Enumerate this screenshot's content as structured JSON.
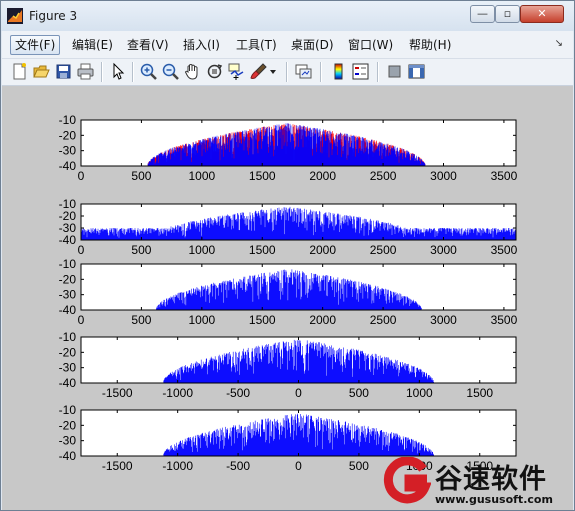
{
  "window": {
    "title": "Figure 3",
    "controls": {
      "minimize": "—",
      "maximize": "▫",
      "close": "✕"
    }
  },
  "menu": {
    "items": [
      {
        "label": "文件(F)",
        "active": true
      },
      {
        "label": "编辑(E)"
      },
      {
        "label": "查看(V)"
      },
      {
        "label": "插入(I)"
      },
      {
        "label": "工具(T)"
      },
      {
        "label": "桌面(D)"
      },
      {
        "label": "窗口(W)"
      },
      {
        "label": "帮助(H)"
      }
    ],
    "corner_glyph": "↘"
  },
  "toolbar": {
    "icons": [
      "new-figure-icon",
      "open-file-icon",
      "save-icon",
      "print-icon",
      "edit-plot-arrow-icon",
      "zoom-in-icon",
      "zoom-out-icon",
      "pan-hand-icon",
      "rotate-3d-icon",
      "data-cursor-icon",
      "brush-icon",
      "brush-dropdown-icon",
      "link-plot-icon",
      "insert-colorbar-icon",
      "insert-legend-icon",
      "hide-plot-tools-icon",
      "show-plot-tools-icon"
    ]
  },
  "colors": {
    "series_red": "#ff0000",
    "series_blue": "#0000ff",
    "figure_bg": "#c8c8c8"
  },
  "chart_data": [
    {
      "type": "line",
      "xlim": [
        0,
        3600
      ],
      "ylim": [
        -40,
        -10
      ],
      "xticks": [
        0,
        500,
        1000,
        1500,
        2000,
        2500,
        3000,
        3500
      ],
      "yticks": [
        -10,
        -20,
        -30,
        -40
      ],
      "envelope": {
        "center": 1700,
        "half_width": 1150,
        "peak": -12,
        "periodic": 3600
      },
      "series": [
        {
          "color": "red",
          "x_range": [
            0,
            2950
          ]
        },
        {
          "color": "blue",
          "x_range": [
            0,
            3600
          ]
        }
      ]
    },
    {
      "type": "line",
      "xlim": [
        0,
        3600
      ],
      "ylim": [
        -40,
        -10
      ],
      "xticks": [
        0,
        500,
        1000,
        1500,
        2000,
        2500,
        3000,
        3500
      ],
      "yticks": [
        -10,
        -20,
        -30,
        -40
      ],
      "envelope": {
        "center": 1700,
        "half_width": 1150,
        "peak": -12,
        "periodic": 3600,
        "floor": -30
      },
      "series": [
        {
          "color": "blue",
          "x_range": [
            0,
            3600
          ]
        }
      ]
    },
    {
      "type": "line",
      "xlim": [
        0,
        3600
      ],
      "ylim": [
        -40,
        -10
      ],
      "xticks": [
        0,
        500,
        1000,
        1500,
        2000,
        2500,
        3000,
        3500
      ],
      "yticks": [
        -10,
        -20,
        -30,
        -40
      ],
      "envelope": {
        "center": 1720,
        "half_width": 1100,
        "peak": -13
      },
      "series": [
        {
          "color": "blue",
          "x_range": [
            620,
            2830
          ]
        }
      ]
    },
    {
      "type": "line",
      "xlim": [
        -1800,
        1800
      ],
      "ylim": [
        -40,
        -10
      ],
      "xticks": [
        -1500,
        -1000,
        -500,
        0,
        500,
        1000,
        1500
      ],
      "yticks": [
        -10,
        -20,
        -30,
        -40
      ],
      "envelope": {
        "center": 0,
        "half_width": 1120,
        "peak": -11
      },
      "series": [
        {
          "color": "blue",
          "x_range": [
            -1120,
            1120
          ]
        }
      ]
    },
    {
      "type": "line",
      "xlim": [
        -1800,
        1800
      ],
      "ylim": [
        -40,
        -10
      ],
      "xticks": [
        -1500,
        -1000,
        -500,
        0,
        500,
        1000,
        1500
      ],
      "yticks": [
        -10,
        -20,
        -30,
        -40
      ],
      "envelope": {
        "center": 0,
        "half_width": 1120,
        "peak": -12
      },
      "series": [
        {
          "color": "blue",
          "x_range": [
            -1120,
            1120
          ]
        }
      ]
    }
  ],
  "watermark": {
    "brand": "谷速软件",
    "url": "www.gususoft.com"
  }
}
